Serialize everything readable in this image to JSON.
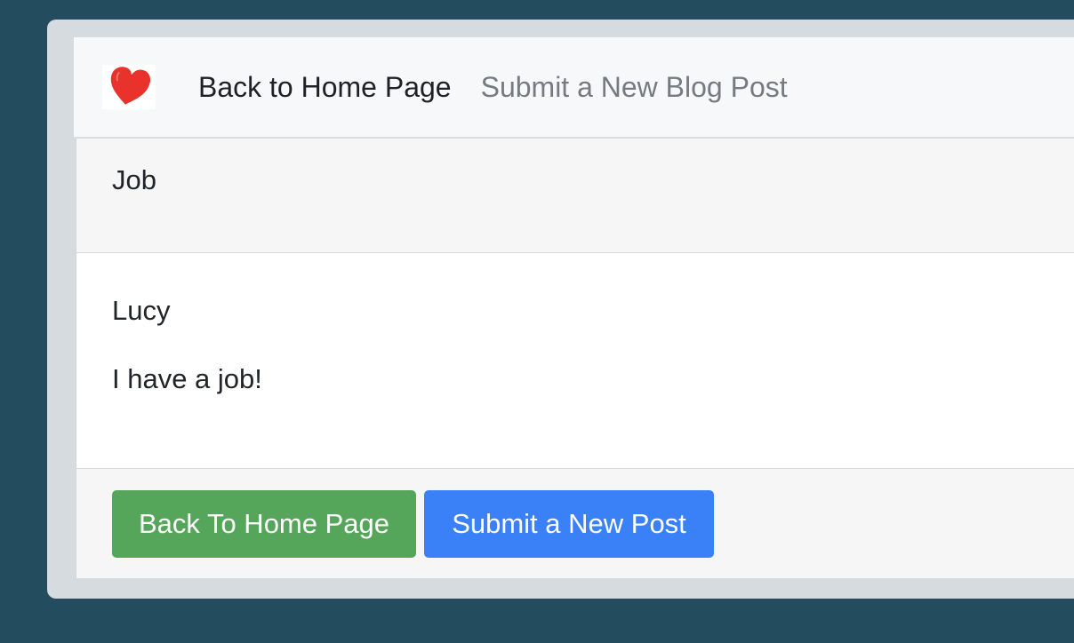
{
  "navbar": {
    "brand_icon": "heart-icon",
    "home_link": "Back to Home Page",
    "submit_link": "Submit a New Blog Post"
  },
  "post": {
    "title": "Job",
    "author": "Lucy",
    "content": "I have a job!"
  },
  "footer": {
    "home_button": "Back To Home Page",
    "submit_button": "Submit a New Post"
  },
  "colors": {
    "background": "#234d5e",
    "green_button": "#55a65a",
    "blue_button": "#3a80f6",
    "heart": "#e8322b"
  }
}
